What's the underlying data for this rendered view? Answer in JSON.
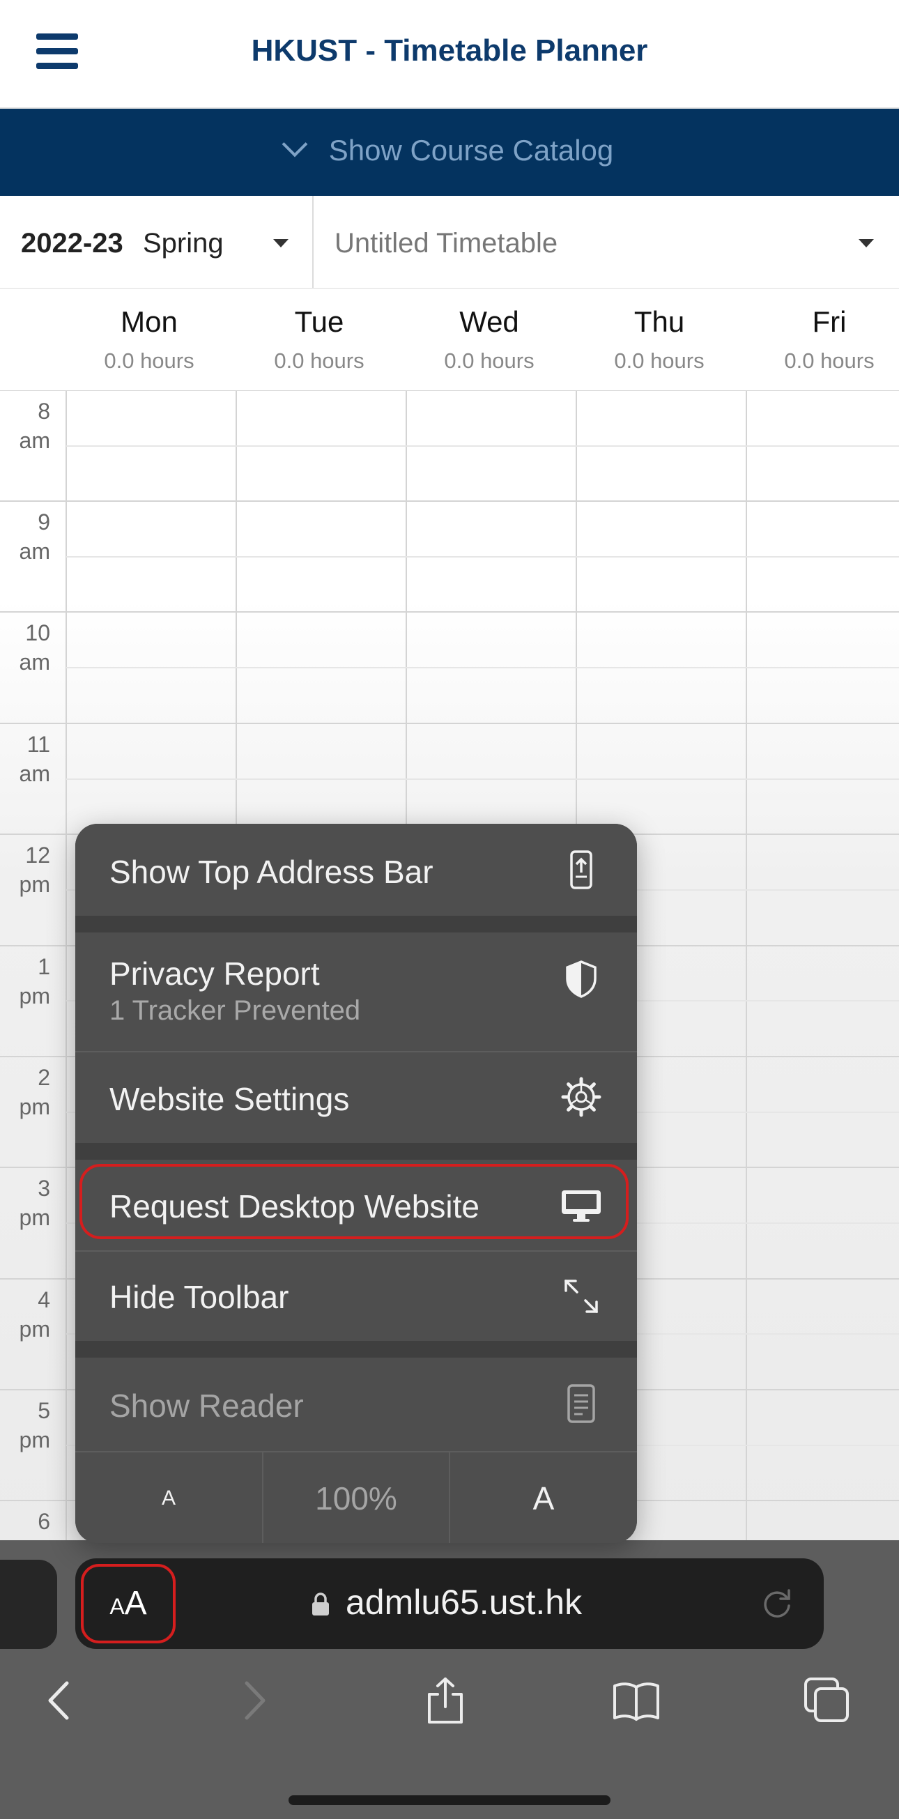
{
  "header": {
    "title": "HKUST - Timetable Planner",
    "menu_icon": "hamburger-menu-icon"
  },
  "catalog": {
    "label": "Show Course Catalog",
    "icon": "chevron-down-icon"
  },
  "selector": {
    "year": "2022-23",
    "semester": "Spring",
    "timetable_name": "Untitled Timetable"
  },
  "days": [
    {
      "name": "Mon",
      "hours": "0.0 hours"
    },
    {
      "name": "Tue",
      "hours": "0.0 hours"
    },
    {
      "name": "Wed",
      "hours": "0.0 hours"
    },
    {
      "name": "Thu",
      "hours": "0.0 hours"
    },
    {
      "name": "Fri",
      "hours": "0.0 hours"
    }
  ],
  "times": [
    {
      "num": "8",
      "ampm": "am"
    },
    {
      "num": "9",
      "ampm": "am"
    },
    {
      "num": "10",
      "ampm": "am"
    },
    {
      "num": "11",
      "ampm": "am"
    },
    {
      "num": "12",
      "ampm": "pm"
    },
    {
      "num": "1",
      "ampm": "pm"
    },
    {
      "num": "2",
      "ampm": "pm"
    },
    {
      "num": "3",
      "ampm": "pm"
    },
    {
      "num": "4",
      "ampm": "pm"
    },
    {
      "num": "5",
      "ampm": "pm"
    },
    {
      "num": "6",
      "ampm": ""
    }
  ],
  "menu": {
    "show_top_address_bar": "Show Top Address Bar",
    "privacy_report": "Privacy Report",
    "privacy_sub": "1 Tracker Prevented",
    "website_settings": "Website Settings",
    "request_desktop": "Request Desktop Website",
    "hide_toolbar": "Hide Toolbar",
    "show_reader": "Show Reader",
    "font_small": "A",
    "zoom": "100%",
    "font_large": "A"
  },
  "address_bar": {
    "aa_small": "A",
    "aa_large": "A",
    "url": "admlu65.ust.hk"
  },
  "colors": {
    "brand": "#0d3a6c",
    "catalog_bar": "#04335f",
    "highlight": "#d51e1e",
    "menu_bg": "#4e4e4e"
  }
}
